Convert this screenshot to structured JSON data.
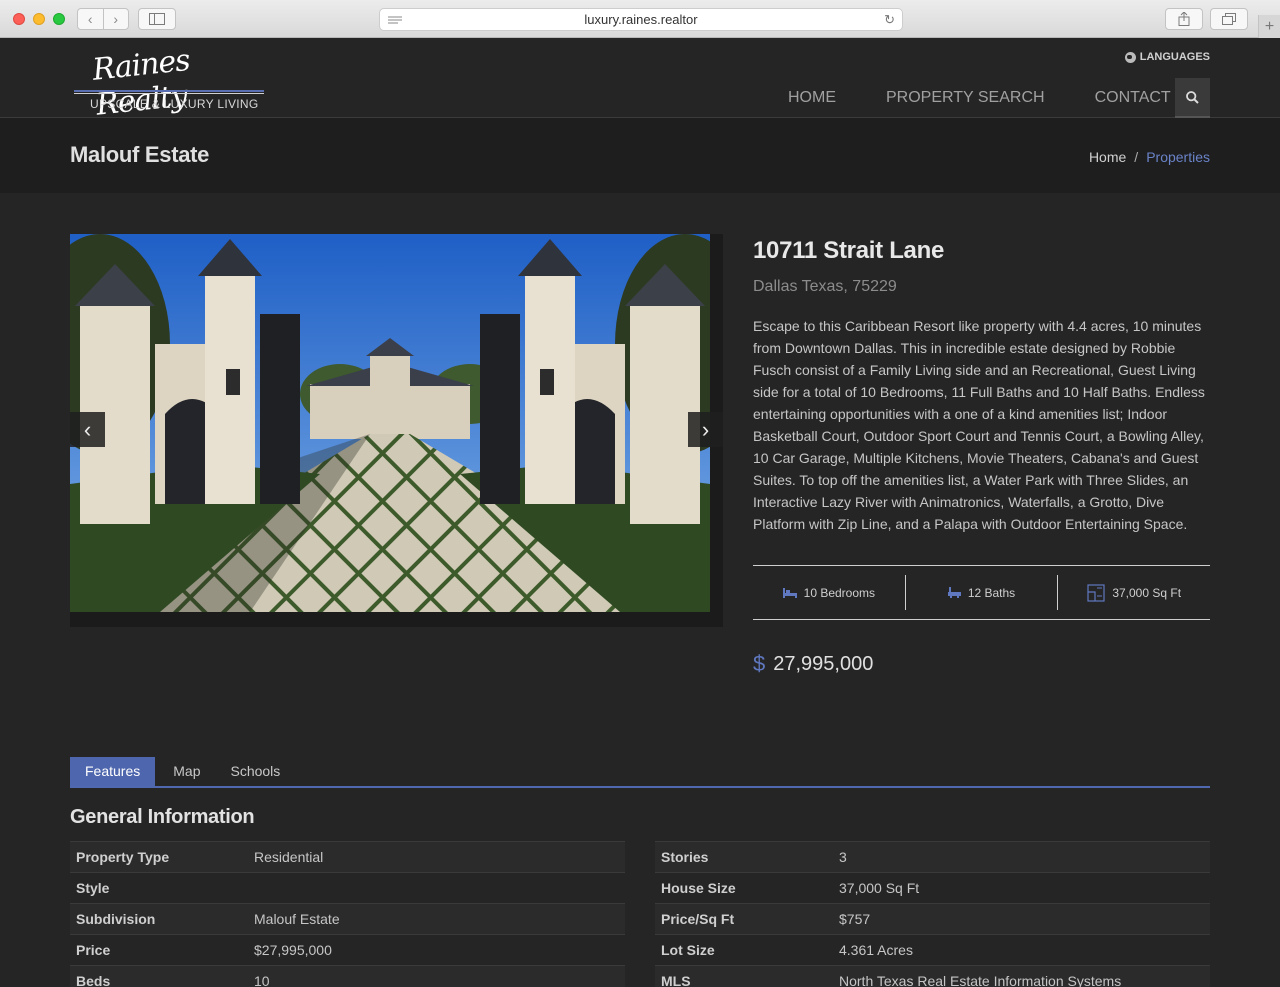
{
  "browser": {
    "url": "luxury.raines.realtor"
  },
  "header": {
    "logo_script": "Raines Realty",
    "logo_tagline": "UPSCALE & LUXURY LIVING",
    "languages_label": "LANGUAGES",
    "nav": [
      {
        "label": "HOME"
      },
      {
        "label": "PROPERTY SEARCH"
      },
      {
        "label": "CONTACT"
      }
    ]
  },
  "titleband": {
    "title": "Malouf Estate",
    "breadcrumb": {
      "home": "Home",
      "separator": "/",
      "current": "Properties"
    }
  },
  "property": {
    "address": "10711 Strait Lane",
    "city": "Dallas Texas, 75229",
    "description": "Escape to this Caribbean Resort like property with 4.4 acres, 10 minutes from Downtown Dallas. This in incredible estate designed by Robbie Fusch consist of a Family Living side and an Recreational, Guest Living side for a total of 10 Bedrooms, 11 Full Baths and 10 Half Baths. Endless entertaining opportunities with a one of a kind amenities list; Indoor Basketball Court, Outdoor Sport Court and Tennis Court, a Bowling Alley, 10 Car Garage, Multiple Kitchens, Movie Theaters, Cabana's and Guest Suites. To top off the amenities list, a Water Park with Three Slides, an Interactive Lazy River with Animatronics, Waterfalls, a Grotto, Dive Platform with Zip Line, and a Palapa with Outdoor Entertaining Space.",
    "stats": {
      "bedrooms": "10 Bedrooms",
      "baths": "12 Baths",
      "sqft": "37,000 Sq Ft"
    },
    "price_symbol": "$",
    "price": "27,995,000"
  },
  "tabs": [
    {
      "label": "Features"
    },
    {
      "label": "Map"
    },
    {
      "label": "Schools"
    }
  ],
  "general_info": {
    "title": "General Information",
    "left": [
      {
        "key": "Property Type",
        "value": "Residential"
      },
      {
        "key": "Style",
        "value": ""
      },
      {
        "key": "Subdivision",
        "value": "Malouf Estate"
      },
      {
        "key": "Price",
        "value": "$27,995,000"
      },
      {
        "key": "Beds",
        "value": "10"
      }
    ],
    "right": [
      {
        "key": "Stories",
        "value": "3"
      },
      {
        "key": "House Size",
        "value": "37,000 Sq Ft"
      },
      {
        "key": "Price/Sq Ft",
        "value": "$757"
      },
      {
        "key": "Lot Size",
        "value": "4.361 Acres"
      },
      {
        "key": "MLS",
        "value": "North Texas Real Estate Information Systems"
      }
    ]
  },
  "colors": {
    "accent": "#4e66ad",
    "link": "#6a83c8",
    "background": "#252525"
  }
}
